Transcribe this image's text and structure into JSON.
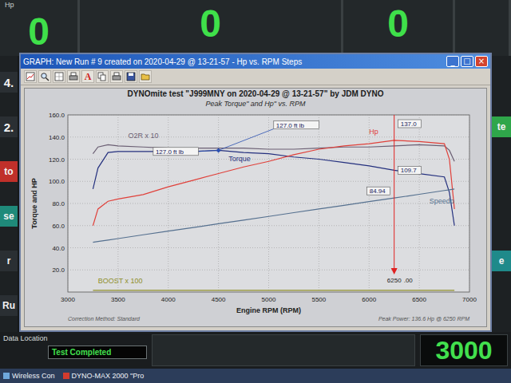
{
  "backdrop": {
    "corner_label": "Hp",
    "readouts": [
      {
        "value": "0"
      },
      {
        "value": "0"
      },
      {
        "value": "0"
      }
    ],
    "left_tabs": [
      {
        "text": "4.",
        "color": "#2a2f33"
      },
      {
        "text": "2.",
        "color": "#2a2f33"
      },
      {
        "text": "to",
        "color": "#c0302a"
      },
      {
        "text": "se",
        "color": "#1f8a7a"
      },
      {
        "text": "r",
        "color": "#2a2f33"
      },
      {
        "text": "Ru",
        "color": "#2a2f33"
      }
    ],
    "right_tabs": [
      {
        "text": "te",
        "color": "#2fa64a"
      },
      {
        "text": "e",
        "color": "#1f8a8a"
      }
    ],
    "data_location": "Data Location",
    "status": "Test Completed",
    "rpm_readout": "3000"
  },
  "taskbar": {
    "items": [
      "Wireless Con",
      "DYNO-MAX 2000 \"Pro"
    ]
  },
  "window": {
    "title": "GRAPH: New Run # 9 created on 2020-04-29 @ 13-21-57 - Hp vs. RPM Steps",
    "controls": [
      "_",
      "□",
      "×"
    ]
  },
  "toolbar": {
    "text_button": "A"
  },
  "chart": {
    "title": "DYNOmite test \"J999MNY on 2020-04-29 @ 13-21-57\" by JDM DYNO",
    "subtitle": "Peak Torque\" and Hp\" vs. RPM",
    "y_axis": {
      "label": "Torque and HP",
      "ticks": [
        "160.0",
        "140.0",
        "120.0",
        "100.0",
        "80.0",
        "60.0",
        "40.0",
        "20.0"
      ]
    },
    "x_axis": {
      "label": "Engine RPM (RPM)",
      "ticks": [
        "3000",
        "3500",
        "4000",
        "4500",
        "5000",
        "5500",
        "6000",
        "6500",
        "7000"
      ]
    },
    "rpm": [
      3250,
      3300,
      3400,
      3500,
      3750,
      4000,
      4250,
      4500,
      4750,
      5000,
      5250,
      5500,
      5750,
      6000,
      6250,
      6500,
      6750,
      6800,
      6850
    ],
    "series": [
      {
        "name": "O2R x 10",
        "color": "#6b5f73",
        "values": [
          125,
          131,
          133,
          132,
          131,
          130,
          130,
          130,
          130,
          129,
          129,
          130,
          131,
          131,
          132,
          133,
          132,
          128,
          118
        ]
      },
      {
        "name": "Torque",
        "color": "#24307e",
        "values": [
          93,
          112,
          126,
          127,
          127,
          127,
          127,
          128,
          126,
          125,
          122,
          120,
          117,
          114,
          110,
          107,
          104,
          90,
          60
        ]
      },
      {
        "name": "Hp",
        "color": "#e0403a",
        "values": [
          60,
          75,
          82,
          84,
          88,
          95,
          101,
          107,
          113,
          118,
          124,
          129,
          132,
          134,
          137,
          136,
          134,
          120,
          75
        ]
      },
      {
        "name": "Speedo",
        "color": "#55708f",
        "values": [
          45,
          45.7,
          47,
          48.3,
          51.7,
          55,
          58.3,
          61.7,
          65,
          68.3,
          71.7,
          75,
          78.3,
          81.7,
          84.9,
          88.3,
          91.7,
          92.3,
          93
        ]
      },
      {
        "name": "BOOST x 100",
        "color": "#8f8f2a",
        "values": [
          1.5,
          1.5,
          1.5,
          1.5,
          1.5,
          1.5,
          1.5,
          1.5,
          1.5,
          1.5,
          1.5,
          1.5,
          1.5,
          1.5,
          1.5,
          1.5,
          1.5,
          1.5,
          1.5
        ]
      }
    ],
    "peak_labels": [
      "127.0 ft lb",
      "127.0 ft lb"
    ],
    "cursor": {
      "rpm": "6250",
      "decimals": ".00",
      "readouts": [
        {
          "series": "Hp",
          "text": "137.0"
        },
        {
          "series": "Torque",
          "text": "109.7"
        },
        {
          "series": "Speedo",
          "text": "84.94"
        }
      ]
    },
    "correction": "Correction Method: Standard",
    "peak_power": "Peak Power: 136.6 Hp @ 6250 RPM"
  }
}
